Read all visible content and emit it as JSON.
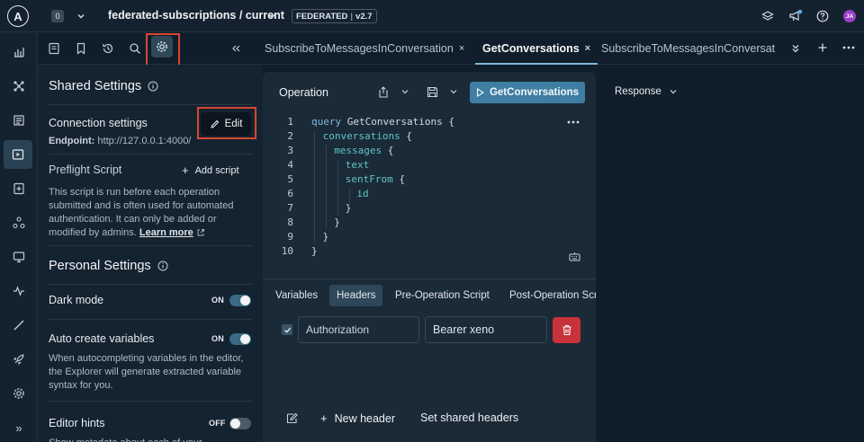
{
  "topbar": {
    "workspace_badge": "0",
    "graph_name": "federated-subscriptions / current",
    "variant_badge_a": "FEDERATED",
    "variant_badge_b": "v2.7",
    "avatar_initials": "JA"
  },
  "rail": {
    "items": [
      "home-icon",
      "graph-icon",
      "docs-icon",
      "explorer-icon",
      "schema-icon",
      "subgraphs-icon",
      "checks-icon",
      "monitor-icon",
      "insights-icon",
      "launches-icon",
      "settings-icon"
    ],
    "expand_glyph": "»"
  },
  "settings": {
    "shared_title": "Shared Settings",
    "connection_title": "Connection settings",
    "edit_label": "Edit",
    "endpoint_label": "Endpoint:",
    "endpoint_value": "http://127.0.0.1:4000/",
    "preflight_title": "Preflight Script",
    "add_script_label": "Add script",
    "preflight_desc": "This script is run before each operation submitted and is often used for automated authentication. It can only be added or modified by admins.",
    "learn_more": "Learn more",
    "personal_title": "Personal Settings",
    "dark_mode_label": "Dark mode",
    "dark_mode_state": "ON",
    "auto_vars_label": "Auto create variables",
    "auto_vars_state": "ON",
    "auto_vars_desc": "When autocompleting variables in the editor, the Explorer will generate extracted variable syntax for you.",
    "hints_label": "Editor hints",
    "hints_state": "OFF",
    "hints_desc": "Show metadata about each of your"
  },
  "tabs": [
    {
      "label": "SubscribeToMessagesInConversation",
      "close": "×"
    },
    {
      "label": "GetConversations",
      "close": "×"
    },
    {
      "label": "SubscribeToMessagesInConversat"
    }
  ],
  "operation": {
    "title": "Operation",
    "run_label": "GetConversations",
    "code_lines": [
      {
        "n": "1",
        "indent": 0,
        "parts": [
          [
            "kw",
            "query "
          ],
          [
            "pun",
            "GetConversations {"
          ]
        ]
      },
      {
        "n": "2",
        "indent": 1,
        "parts": [
          [
            "fld",
            "conversations"
          ],
          [
            "pun",
            " {"
          ]
        ]
      },
      {
        "n": "3",
        "indent": 2,
        "parts": [
          [
            "fld",
            "messages"
          ],
          [
            "pun",
            " {"
          ]
        ]
      },
      {
        "n": "4",
        "indent": 3,
        "parts": [
          [
            "fld",
            "text"
          ]
        ]
      },
      {
        "n": "5",
        "indent": 3,
        "parts": [
          [
            "fld",
            "sentFrom"
          ],
          [
            "pun",
            " {"
          ]
        ]
      },
      {
        "n": "6",
        "indent": 4,
        "parts": [
          [
            "fld",
            "id"
          ]
        ]
      },
      {
        "n": "7",
        "indent": 3,
        "parts": [
          [
            "pun",
            "}"
          ]
        ]
      },
      {
        "n": "8",
        "indent": 2,
        "parts": [
          [
            "pun",
            "}"
          ]
        ]
      },
      {
        "n": "9",
        "indent": 1,
        "parts": [
          [
            "pun",
            "}"
          ]
        ]
      },
      {
        "n": "10",
        "indent": 0,
        "parts": [
          [
            "pun",
            "}"
          ]
        ]
      }
    ],
    "bottom_tabs": [
      "Variables",
      "Headers",
      "Pre-Operation Script",
      "Post-Operation Scr"
    ],
    "header_key": "Authorization",
    "header_value": "Bearer xeno",
    "new_header_label": "New header",
    "shared_headers_label": "Set shared headers"
  },
  "response": {
    "title": "Response"
  },
  "colors": {
    "accent": "#3f7ea3",
    "highlight_box": "#d84630",
    "delete_red": "#c8323a"
  }
}
